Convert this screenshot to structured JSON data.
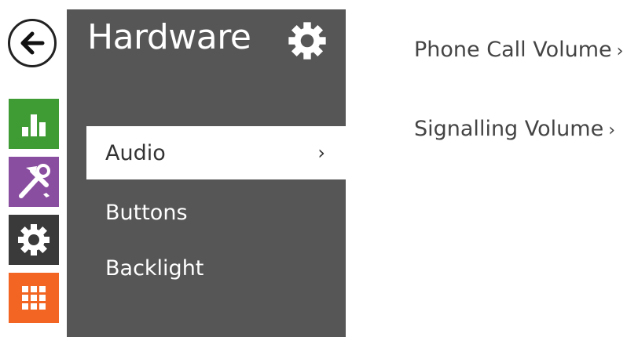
{
  "nav": {
    "back_icon": "arrow-left-icon",
    "items": [
      {
        "icon": "bar-chart-icon",
        "color": "#3f9c35"
      },
      {
        "icon": "tools-icon",
        "color": "#8a4ea0"
      },
      {
        "icon": "gear-icon",
        "color": "#3a3a3a"
      },
      {
        "icon": "grid-icon",
        "color": "#f26522"
      }
    ]
  },
  "panel": {
    "title": "Hardware",
    "items": [
      {
        "label": "Audio",
        "active": true,
        "chevron": "›"
      },
      {
        "label": "Buttons",
        "active": false
      },
      {
        "label": "Backlight",
        "active": false
      }
    ]
  },
  "content": {
    "links": [
      {
        "label": "Phone Call Volume",
        "chevron": "›"
      },
      {
        "label": "Signalling Volume",
        "chevron": "›"
      }
    ]
  }
}
